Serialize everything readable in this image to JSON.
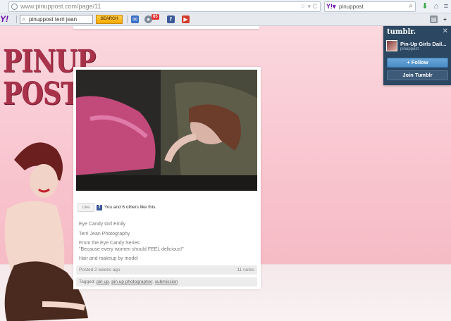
{
  "browser": {
    "url": "www.pinuppost.com/page/11",
    "search_engine_value": "pinuppost"
  },
  "toolbar": {
    "search_value": "pinuppost terri jean",
    "search_button": "SEARCH",
    "mail_count": "65"
  },
  "site": {
    "logo_line1": "PINUP",
    "logo_line2": "POST"
  },
  "post": {
    "like_button": "Like",
    "like_text": "You and 6 others like this.",
    "captions": [
      "Eye Candy Girl Emily",
      "Terri Jean Photography",
      "From the Eye Candy Series",
      "\"Because every women should FEEL delicious!\"",
      "Hair and makeup by model"
    ],
    "posted": "Posted 2 weeks ago",
    "notes": "11 notes",
    "tags_prefix": "Tagged:",
    "tags": [
      "pin up",
      "pin up photographer",
      "submission"
    ]
  },
  "tumblr_widget": {
    "logo": "tumblr.",
    "blog_name": "Pin-Up Girls Dail...",
    "blog_user": "pinuppost",
    "follow_label": "+ Follow",
    "join_label": "Join Tumblr"
  },
  "colors": {
    "page_pink": "#f8c2cc",
    "logo_red": "#a8324a",
    "tumblr_navy": "#2c4762",
    "follow_blue": "#4a8cc5"
  }
}
